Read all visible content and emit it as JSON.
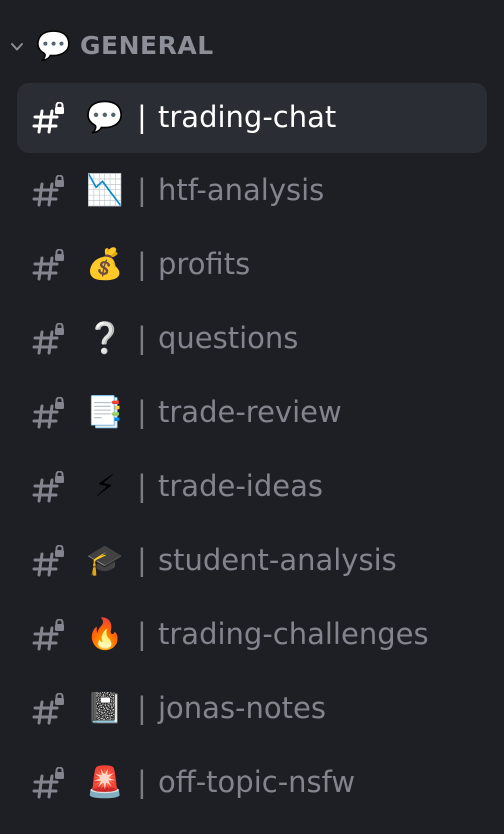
{
  "category": {
    "emoji": "💬",
    "label": "GENERAL"
  },
  "separator": "|",
  "channels": [
    {
      "emoji": "💬",
      "label": "trading-chat",
      "active": true
    },
    {
      "emoji": "📉",
      "label": "htf-analysis",
      "active": false
    },
    {
      "emoji": "💰",
      "label": "profits",
      "active": false
    },
    {
      "emoji": "❔",
      "label": "questions",
      "active": false
    },
    {
      "emoji": "📑",
      "label": "trade-review",
      "active": false
    },
    {
      "emoji": "⚡",
      "label": "trade-ideas",
      "active": false
    },
    {
      "emoji": "🎓",
      "label": "student-analysis",
      "active": false
    },
    {
      "emoji": "🔥",
      "label": "trading-challenges",
      "active": false
    },
    {
      "emoji": "📓",
      "label": "jonas-notes",
      "active": false
    },
    {
      "emoji": "🚨",
      "label": "off-topic-nsfw",
      "active": false
    }
  ],
  "colors": {
    "background": "#1e1f24",
    "active_row": "#2b2d34",
    "text_muted": "#82858e",
    "text_active": "#ffffff"
  }
}
